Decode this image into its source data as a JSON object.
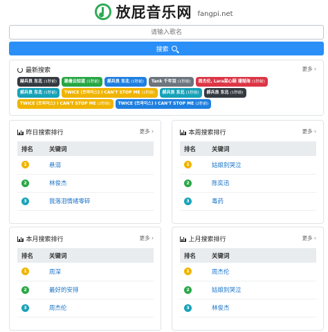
{
  "header": {
    "title": "放屁音乐网",
    "domain": "fangpi.net"
  },
  "search": {
    "placeholder": "请输入歌名",
    "button_label": "搜索"
  },
  "recent": {
    "title": "最新搜索",
    "more": "更多 ›",
    "tags": [
      {
        "name": "赫兵良 东北",
        "count": "(1秒前)",
        "color": "#343a40"
      },
      {
        "name": "跪着云知道",
        "count": "(1秒前)",
        "color": "#28a745"
      },
      {
        "name": "郝兵良 东北",
        "count": "(1秒前)",
        "color": "#1f7fe0"
      },
      {
        "name": "Tank 千年泪",
        "count": "(1秒前)",
        "color": "#6c757d"
      },
      {
        "name": "周杰伦, Lara梁心颐 珊瑚海",
        "count": "(1秒前)",
        "color": "#dc3545"
      },
      {
        "name": "郝兵良 东北",
        "count": "(1秒前)",
        "color": "#17a2b8"
      },
      {
        "name": "TWICE (트와이스) I CAN'T STOP ME",
        "count": "(1秒前)",
        "color": "#f0b400"
      },
      {
        "name": "郝兵良 东北",
        "count": "(1秒前)",
        "color": "#17a2b8"
      },
      {
        "name": "郝兵良 东北",
        "count": "(1秒前)",
        "color": "#343a40"
      },
      {
        "name": "TWICE (트와이스) I CAN'T STOP ME",
        "count": "(2秒前)",
        "color": "#f0b400"
      },
      {
        "name": "TWICE (트와이스) I CAN'T STOP ME",
        "count": "(2秒前)",
        "color": "#1f7fe0"
      }
    ]
  },
  "rank_headers": {
    "rank": "排名",
    "keyword": "关键词"
  },
  "more_label": "更多 ›",
  "rankings": [
    {
      "title": "昨日搜索排行",
      "items": [
        "悬溺",
        "林俊杰",
        "我落泪情绪零碎"
      ]
    },
    {
      "title": "本周搜索排行",
      "items": [
        "姑娘别哭泣",
        "陈奕迅",
        "毒药"
      ]
    },
    {
      "title": "本月搜索排行",
      "items": [
        "周深",
        "最好的安排",
        "周杰伦"
      ]
    },
    {
      "title": "上月搜索排行",
      "items": [
        "周杰伦",
        "姑娘别哭泣",
        "林俊杰"
      ]
    }
  ],
  "badges": [
    {
      "num": "1",
      "color": "#f0b400"
    },
    {
      "num": "2",
      "color": "#28a745"
    },
    {
      "num": "3",
      "color": "#17a2b8"
    }
  ]
}
